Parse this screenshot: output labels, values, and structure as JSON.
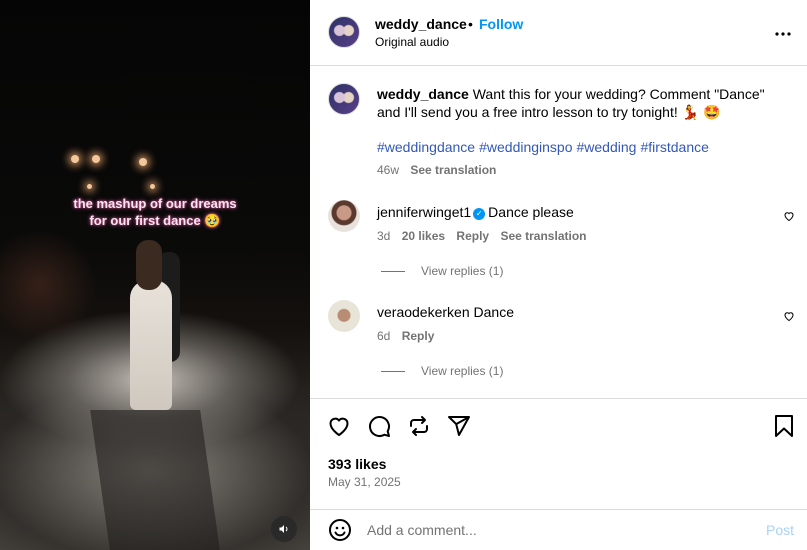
{
  "video": {
    "caption_line1": "the mashup of our dreams",
    "caption_line2": "for our first dance 🥹",
    "sound_icon": "speaker-icon"
  },
  "header": {
    "username": "weddy_dance",
    "separator": "•",
    "follow_label": "Follow",
    "audio_label": "Original audio",
    "more_icon": "more-options-icon"
  },
  "post": {
    "username": "weddy_dance",
    "caption": "Want this for your wedding? Comment \"Dance\" and I'll send you a free intro lesson to try tonight! 💃 🤩",
    "hashtags": [
      "#weddingdance",
      "#weddinginspo",
      "#wedding",
      "#firstdance"
    ],
    "age": "46w",
    "see_translation": "See translation"
  },
  "comments": [
    {
      "username": "jenniferwinget1",
      "verified": true,
      "text": "Dance please",
      "age": "3d",
      "likes": "20 likes",
      "reply_label": "Reply",
      "see_translation": "See translation",
      "view_replies": "View replies (1)"
    },
    {
      "username": "veraodekerken",
      "verified": false,
      "text": "Dance",
      "age": "6d",
      "reply_label": "Reply",
      "view_replies": "View replies (1)"
    }
  ],
  "stats": {
    "likes": "393 likes",
    "date": "May 31, 2025"
  },
  "composer": {
    "placeholder": "Add a comment...",
    "post_label": "Post"
  },
  "colors": {
    "link_blue": "#0095f6",
    "hashtag": "#3358b8",
    "muted": "#737373"
  }
}
